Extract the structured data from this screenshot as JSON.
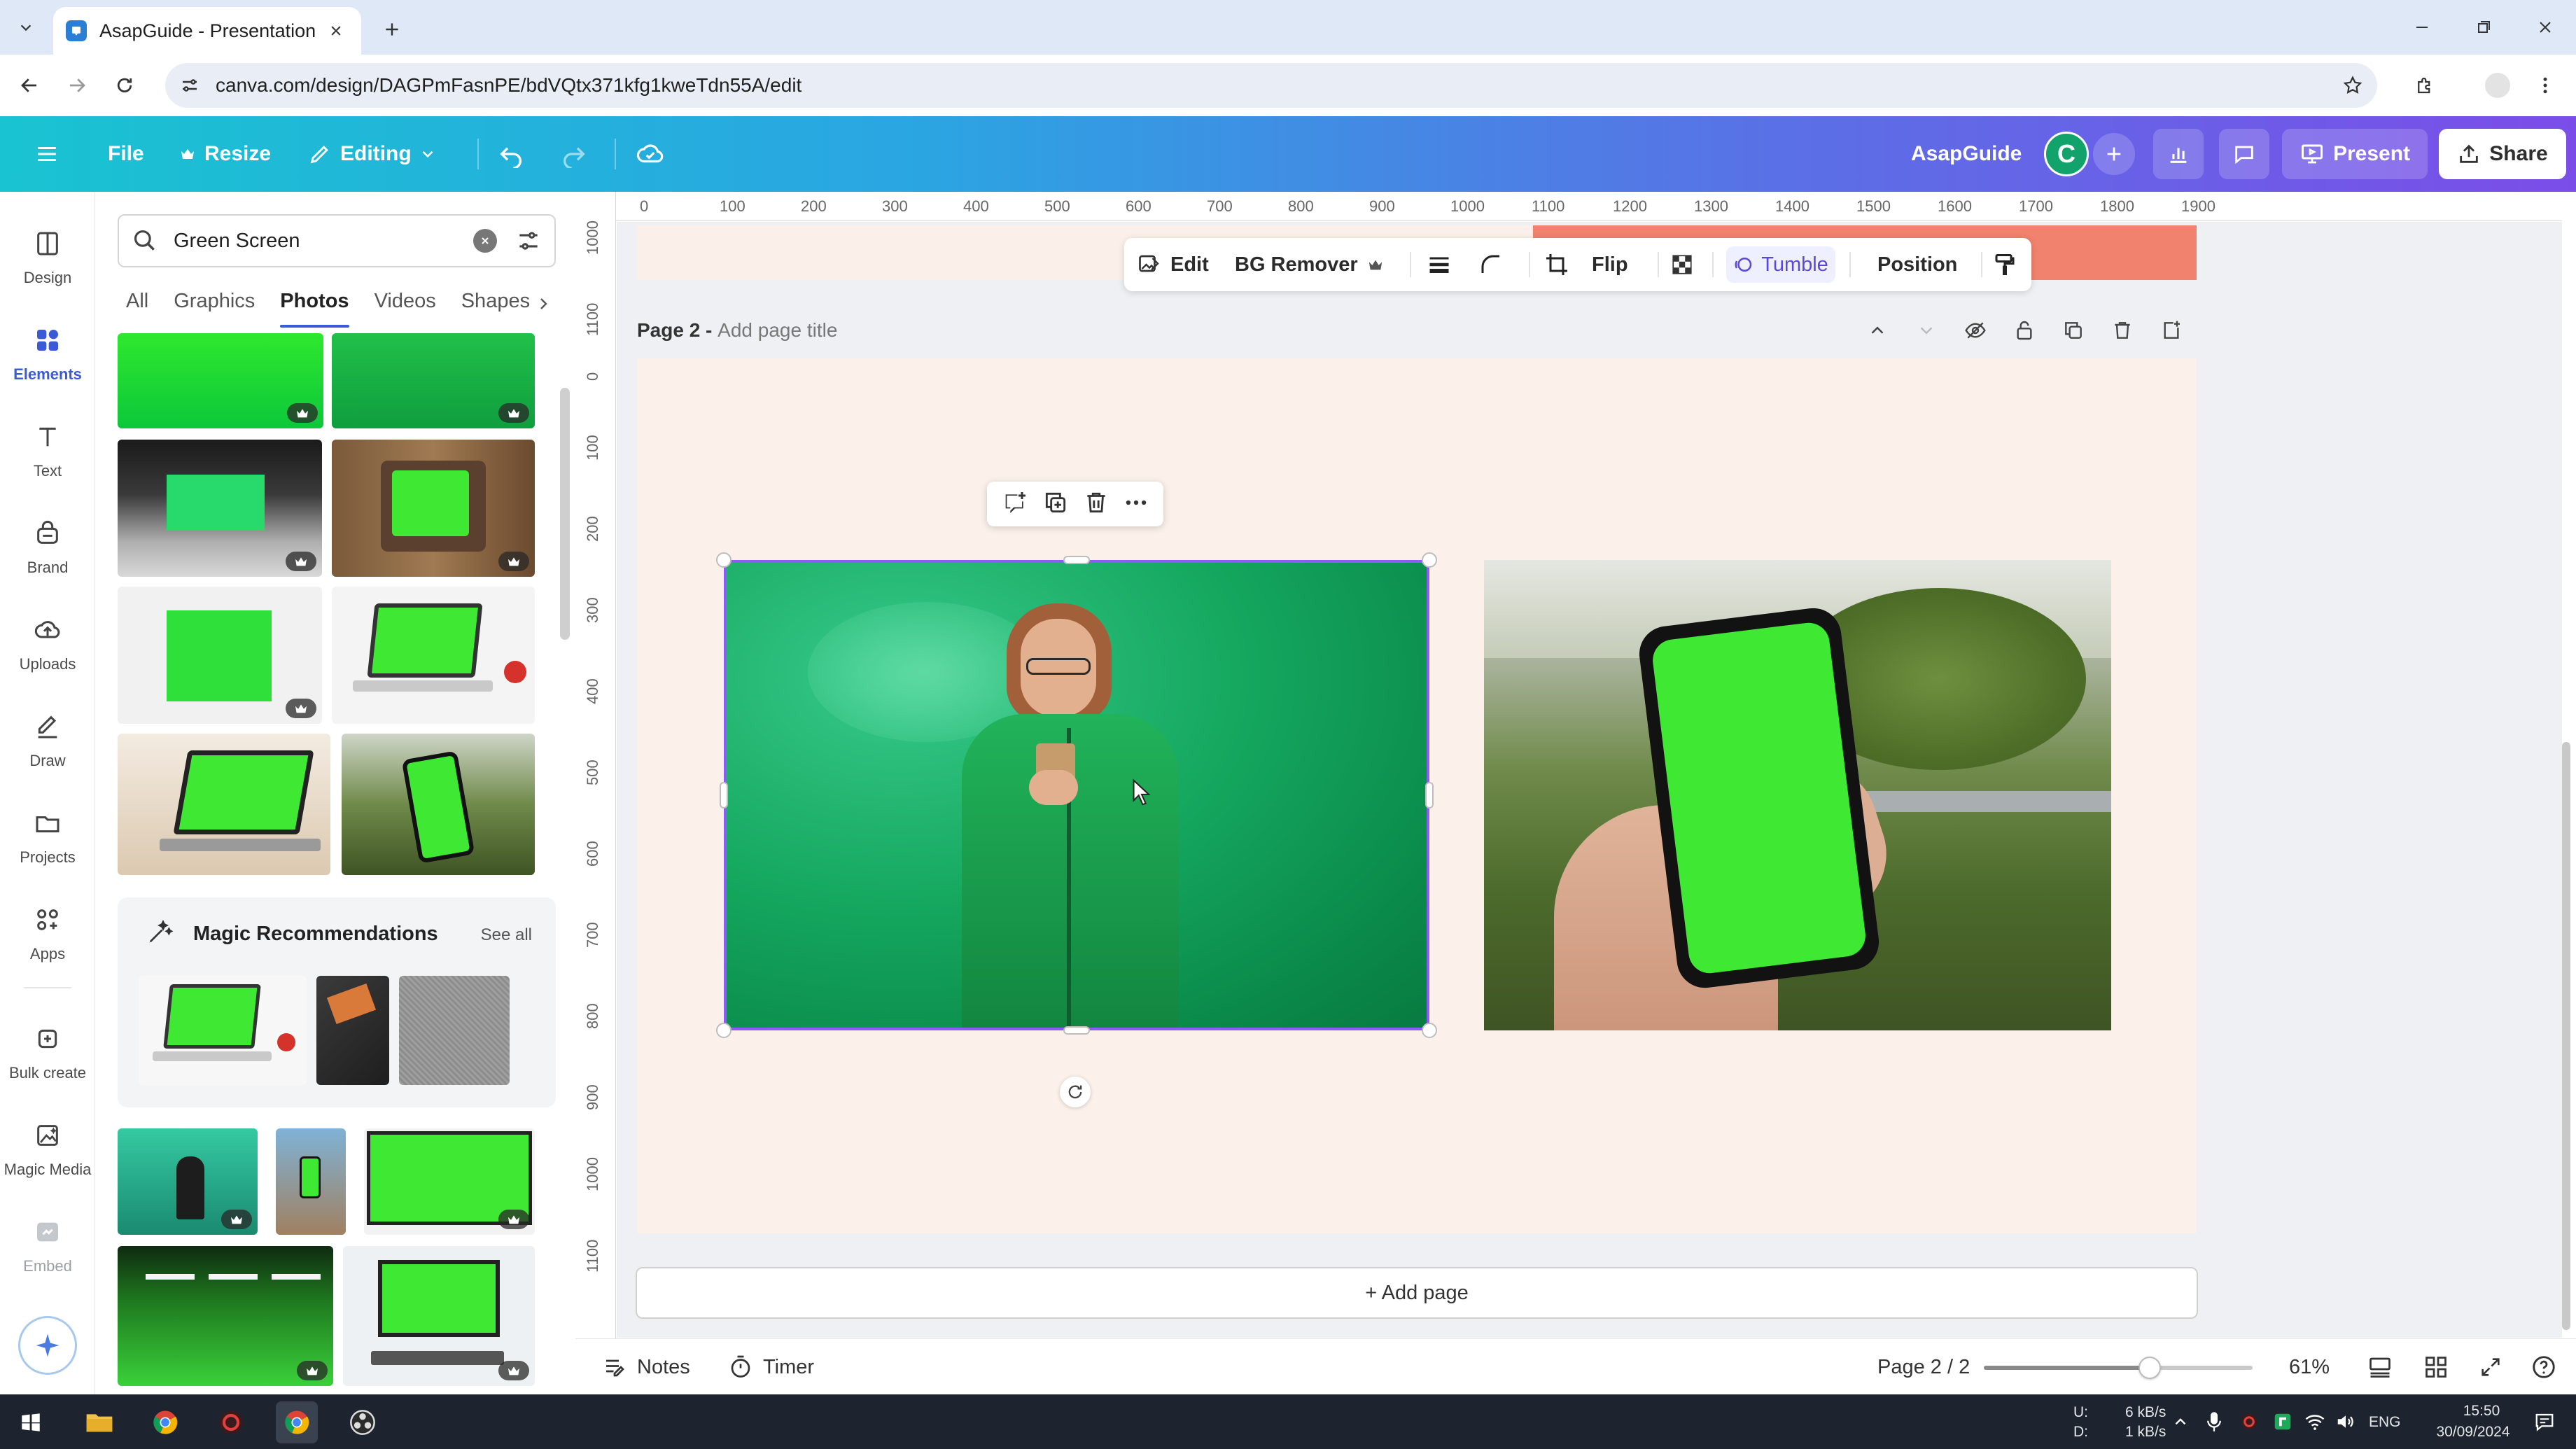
{
  "browser": {
    "tab_title": "AsapGuide - Presentation",
    "url": "canva.com/design/DAGPmFasnPE/bdVQtx371kfg1kweTdn55A/edit"
  },
  "topbar": {
    "file": "File",
    "resize": "Resize",
    "editing": "Editing",
    "team_name": "AsapGuide",
    "avatar_letter": "C",
    "present": "Present",
    "share": "Share"
  },
  "rail": [
    {
      "label": "Design",
      "icon": "design-icon"
    },
    {
      "label": "Elements",
      "icon": "elements-icon"
    },
    {
      "label": "Text",
      "icon": "text-icon"
    },
    {
      "label": "Brand",
      "icon": "brand-icon"
    },
    {
      "label": "Uploads",
      "icon": "uploads-icon"
    },
    {
      "label": "Draw",
      "icon": "draw-icon"
    },
    {
      "label": "Projects",
      "icon": "projects-icon"
    },
    {
      "label": "Apps",
      "icon": "apps-icon"
    },
    {
      "label": "Bulk create",
      "icon": "bulk-create-icon"
    },
    {
      "label": "Magic Media",
      "icon": "magic-media-icon"
    },
    {
      "label": "Embed",
      "icon": "embed-icon"
    }
  ],
  "panel": {
    "search_value": "Green Screen",
    "tabs": [
      "All",
      "Graphics",
      "Photos",
      "Videos",
      "Shapes"
    ],
    "active_tab": "Photos",
    "magic_title": "Magic Recommendations",
    "see_all": "See all"
  },
  "ruler": {
    "top": [
      "0",
      "100",
      "200",
      "300",
      "400",
      "500",
      "600",
      "700",
      "800",
      "900",
      "1000",
      "1100",
      "1200",
      "1300",
      "1400",
      "1500",
      "1600",
      "1700",
      "1800",
      "1900"
    ],
    "left": [
      "1000",
      "1100",
      "0",
      "100",
      "200",
      "300",
      "400",
      "500",
      "600",
      "700",
      "800",
      "900",
      "1000",
      "1100"
    ]
  },
  "context_toolbar": {
    "edit": "Edit",
    "bg_remover": "BG Remover",
    "flip": "Flip",
    "tumble": "Tumble",
    "position": "Position"
  },
  "page": {
    "label": "Page 2",
    "separator": " - ",
    "title_placeholder": "Add page title",
    "add_page": "+ Add page"
  },
  "footer": {
    "notes": "Notes",
    "timer": "Timer",
    "page_indicator": "Page 2 / 2",
    "zoom_level": 0.61,
    "zoom": "61%"
  },
  "taskbar": {
    "net_up_label": "U:",
    "net_down_label": "D:",
    "net_up": "6 kB/s",
    "net_down": "1 kB/s",
    "lang": "ENG",
    "time": "15:50",
    "date": "30/09/2024"
  },
  "colors": {
    "accent": "#8b5cf6",
    "brand_gradient_start": "#19c3d1",
    "brand_gradient_end": "#7b4de8",
    "page_bg": "#fbf1ea",
    "green_screen": "#3ee833"
  }
}
